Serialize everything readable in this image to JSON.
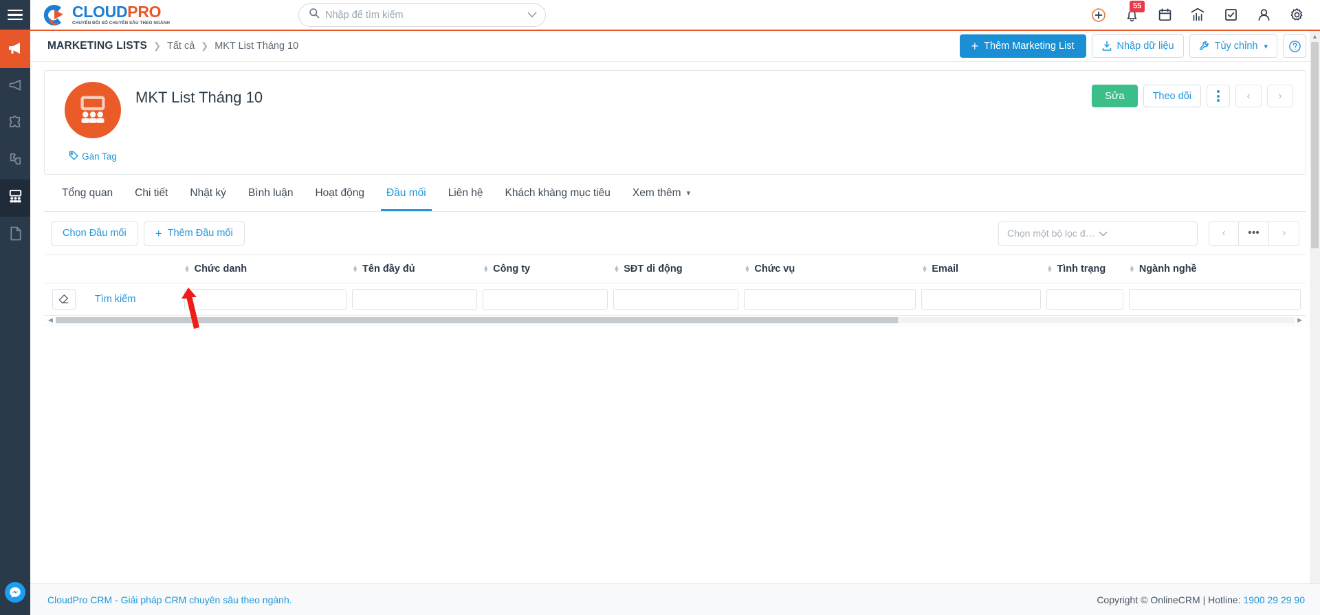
{
  "brand": {
    "name_part1": "CLOUD",
    "name_part2": "PRO",
    "tagline": "CHUYỂN ĐỔI SỐ CHUYÊN SÂU THEO NGÀNH"
  },
  "search": {
    "placeholder": "Nhập để tìm kiếm",
    "value": ""
  },
  "topbar": {
    "icons": [
      {
        "name": "add-circle-icon",
        "label": "Thêm nhanh"
      },
      {
        "name": "bell-icon",
        "label": "Thông báo",
        "badge": "55"
      },
      {
        "name": "calendar-icon",
        "label": "Lịch"
      },
      {
        "name": "analytics-icon",
        "label": "Báo cáo"
      },
      {
        "name": "task-check-icon",
        "label": "Công việc"
      },
      {
        "name": "user-icon",
        "label": "Tài khoản"
      },
      {
        "name": "gear-icon",
        "label": "Cài đặt"
      }
    ]
  },
  "breadcrumb": {
    "root": "MARKETING LISTS",
    "separator": "❯",
    "level2": "Tất cả",
    "current": "MKT List Tháng 10"
  },
  "crumb_actions": {
    "add_label": "Thêm Marketing List",
    "import_label": "Nhập dữ liệu",
    "customize_label": "Tùy chỉnh",
    "help_label": "?"
  },
  "record": {
    "title": "MKT List Tháng 10",
    "tag_label": "Gán Tag",
    "avatar_icon": "marketing-list-people-icon",
    "edit_label": "Sửa",
    "follow_label": "Theo dõi",
    "more_label": "⋮",
    "prev_label": "‹",
    "next_label": "›"
  },
  "tabs": [
    {
      "label": "Tổng quan",
      "active": false
    },
    {
      "label": "Chi tiết",
      "active": false
    },
    {
      "label": "Nhật ký",
      "active": false
    },
    {
      "label": "Bình luận",
      "active": false
    },
    {
      "label": "Hoạt động",
      "active": false
    },
    {
      "label": "Đầu mối",
      "active": true
    },
    {
      "label": "Liên hệ",
      "active": false
    },
    {
      "label": "Khách khàng mục tiêu",
      "active": false
    },
    {
      "label": "Xem thêm",
      "active": false,
      "has_caret": true
    }
  ],
  "grid_toolbar": {
    "choose_label": "Chọn Đầu mối",
    "add_label": "Thêm Đầu mối",
    "filter_placeholder": "Chọn một bộ lọc để thêm vào danh ...",
    "pager_prev": "‹",
    "pager_more": "•••",
    "pager_next": "›"
  },
  "table": {
    "columns": [
      "Chức danh",
      "Tên đầy đủ",
      "Công ty",
      "SĐT di động",
      "Chức vụ",
      "Email",
      "Tình trạng",
      "Ngành nghề"
    ],
    "search_row": {
      "clear_icon": "eraser-icon",
      "search_label": "Tìm kiếm",
      "values": [
        "",
        "",
        "",
        "",
        "",
        "",
        "",
        ""
      ]
    },
    "rows": []
  },
  "footer": {
    "left": "CloudPro CRM - Giải pháp CRM chuyên sâu theo ngành.",
    "copyright": "Copyright © OnlineCRM",
    "divider": "|",
    "hotline_label": "Hotline:",
    "hotline_number": "1900 29 29 90"
  },
  "leftnav": {
    "items": [
      {
        "name": "sidebar-item-campaign",
        "icon": "megaphone-icon",
        "style": "accent"
      },
      {
        "name": "sidebar-item-broadcast",
        "icon": "megaphone-outline-icon",
        "style": "normal"
      },
      {
        "name": "sidebar-item-puzzle",
        "icon": "puzzle-icon",
        "style": "normal"
      },
      {
        "name": "sidebar-item-puzzle-2",
        "icon": "puzzle-alt-icon",
        "style": "normal"
      },
      {
        "name": "sidebar-item-marketing-list",
        "icon": "people-group-icon",
        "style": "active"
      },
      {
        "name": "sidebar-item-document",
        "icon": "document-icon",
        "style": "normal"
      }
    ],
    "messenger_icon": "messenger-icon"
  },
  "colors": {
    "accent_orange": "#e8572a",
    "brand_blue": "#1b8fd4",
    "nav_dark": "#2b3a4a",
    "green": "#3cbe8b",
    "badge_red": "#e83a4a",
    "annotation_red": "#ee1c16"
  }
}
